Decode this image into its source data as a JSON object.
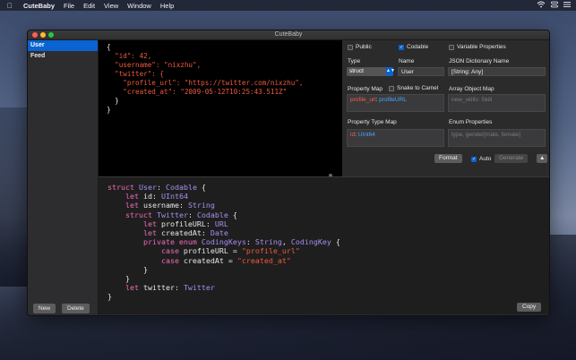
{
  "menubar": {
    "app_name": "CuteBaby",
    "items": [
      "File",
      "Edit",
      "View",
      "Window",
      "Help"
    ]
  },
  "window": {
    "title": "CuteBaby"
  },
  "sidebar": {
    "items": [
      {
        "label": "User",
        "selected": true
      },
      {
        "label": "Feed",
        "selected": false
      }
    ],
    "new_label": "New",
    "delete_label": "Delete"
  },
  "json_input": {
    "lines": [
      "{",
      "  \"id\": 42,",
      "  \"username\": \"nixzhu\",",
      "  \"twitter\": {",
      "    \"profile_url\": \"https://twitter.com/nixzhu\",",
      "    \"created_at\": \"2009-05-12T10:25:43.511Z\"",
      "  }",
      "}"
    ]
  },
  "options": {
    "public_label": "Public",
    "public_checked": false,
    "codable_label": "Codable",
    "codable_checked": true,
    "variable_properties_label": "Variable Properties",
    "variable_properties_checked": false,
    "type_label": "Type",
    "type_value": "struct",
    "name_label": "Name",
    "name_value": "User",
    "json_dictionary_name_label": "JSON Dictionary Name",
    "json_dictionary_name_value": "[String: Any]",
    "property_map_label": "Property Map",
    "snake_to_camel_label": "Snake to Camel",
    "snake_to_camel_checked": false,
    "property_map_key": "profile_url",
    "property_map_value": "profileURL",
    "array_object_map_label": "Array Object Map",
    "array_object_map_placeholder": "new_skills: Skill",
    "property_type_map_label": "Property Type Map",
    "property_type_map_key": "id",
    "property_type_map_value": "UInt64",
    "enum_properties_label": "Enum Properties",
    "enum_properties_placeholder": "type, gender[male, female]"
  },
  "toolbar": {
    "format_label": "Format",
    "auto_label": "Auto",
    "auto_checked": true,
    "generate_label": "Generate"
  },
  "swift_output": {
    "copy_label": "Copy"
  },
  "colors": {
    "accent": "#0a63d1",
    "json_key": "#f05a3e",
    "swift_keyword": "#f06bb8",
    "swift_type": "#a88ef0",
    "swift_string": "#f05a3e"
  }
}
